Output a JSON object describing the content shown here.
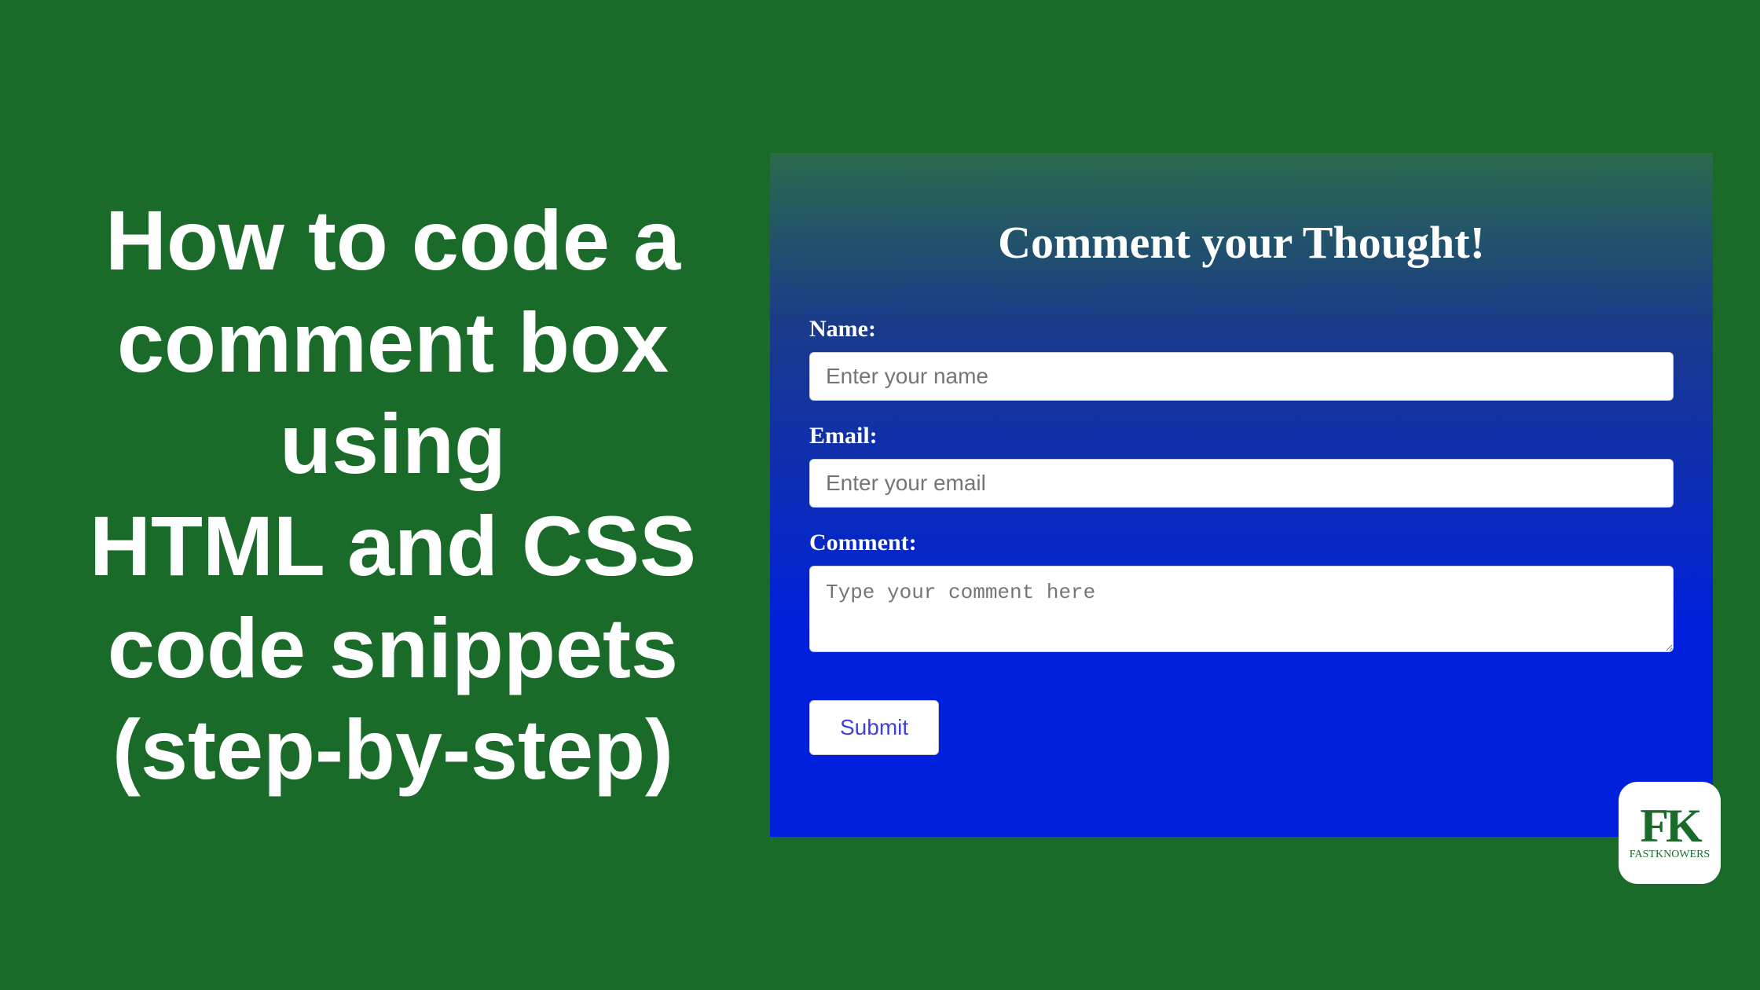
{
  "headline": {
    "line1": "How to code a",
    "line2": "comment box",
    "line3": "using",
    "line4": "HTML and CSS",
    "line5": "code snippets",
    "line6": "(step-by-step)"
  },
  "form": {
    "title": "Comment your Thought!",
    "name": {
      "label": "Name:",
      "placeholder": "Enter your name"
    },
    "email": {
      "label": "Email:",
      "placeholder": "Enter your email"
    },
    "comment": {
      "label": "Comment:",
      "placeholder": "Type your comment here"
    },
    "submit_label": "Submit"
  },
  "logo": {
    "initials": "FK",
    "caption": "FASTKNOWERS"
  }
}
